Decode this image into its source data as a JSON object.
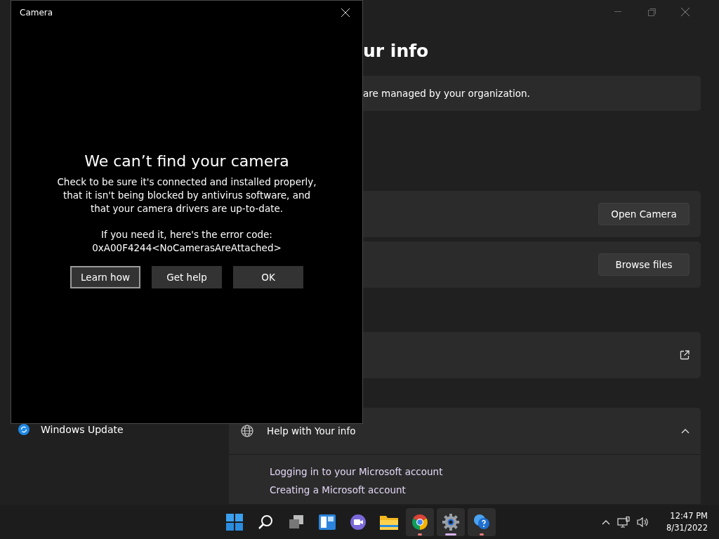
{
  "settings": {
    "sidebar": {
      "items": [
        {
          "label": "Windows Update"
        }
      ]
    },
    "heading": "ur info",
    "notice": "are managed by your organization.",
    "cards": [
      {
        "kind": "button",
        "button": "Open Camera"
      },
      {
        "kind": "button",
        "button": "Browse files"
      },
      {
        "kind": "link"
      }
    ],
    "help": {
      "title": "Help with Your info",
      "expanded": true,
      "links": [
        "Logging in to your Microsoft account",
        "Creating a Microsoft account"
      ]
    }
  },
  "camera_dialog": {
    "title": "Camera",
    "heading": "We can’t find your camera",
    "message": "Check to be sure it's connected and installed properly, that it isn't being blocked by antivirus software, and that your camera drivers are up-to-date.",
    "error_label": "If you need it, here's the error code:",
    "error_code": "0xA00F4244<NoCamerasAreAttached>",
    "buttons": [
      {
        "label": "Learn how",
        "focused": true
      },
      {
        "label": "Get help",
        "focused": false
      },
      {
        "label": "OK",
        "focused": false
      }
    ]
  },
  "taskbar": {
    "apps": [
      {
        "kind": "start",
        "running": false,
        "active": false
      },
      {
        "kind": "search",
        "running": false,
        "active": false
      },
      {
        "kind": "taskview",
        "running": false,
        "active": false
      },
      {
        "kind": "widgets",
        "running": false,
        "active": false
      },
      {
        "kind": "chat",
        "running": false,
        "active": false
      },
      {
        "kind": "explorer",
        "running": false,
        "active": false
      },
      {
        "kind": "browser",
        "running": true,
        "active": false
      },
      {
        "kind": "settings",
        "running": true,
        "active": true
      },
      {
        "kind": "help",
        "running": true,
        "active": false
      }
    ],
    "clock": {
      "time": "12:47 PM",
      "date": "8/31/2022"
    }
  }
}
